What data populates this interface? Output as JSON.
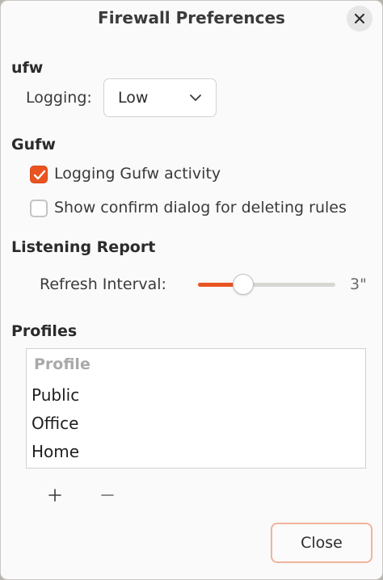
{
  "window": {
    "title": "Firewall Preferences"
  },
  "ufw": {
    "section_title": "ufw",
    "logging_label": "Logging:",
    "logging_value": "Low"
  },
  "gufw": {
    "section_title": "Gufw",
    "options": [
      {
        "label": "Logging Gufw activity",
        "checked": true
      },
      {
        "label": "Show confirm dialog for deleting rules",
        "checked": false
      }
    ]
  },
  "listening_report": {
    "section_title": "Listening Report",
    "refresh_label": "Refresh Interval:",
    "refresh_value_text": "3\"",
    "slider_fraction": 0.33
  },
  "profiles": {
    "section_title": "Profiles",
    "column_header": "Profile",
    "rows": [
      "Public",
      "Office",
      "Home"
    ],
    "add_icon": "plus-icon",
    "remove_icon": "minus-icon"
  },
  "footer": {
    "close_label": "Close"
  },
  "colors": {
    "accent": "#e95420",
    "close_button_border": "#f0b49d"
  }
}
